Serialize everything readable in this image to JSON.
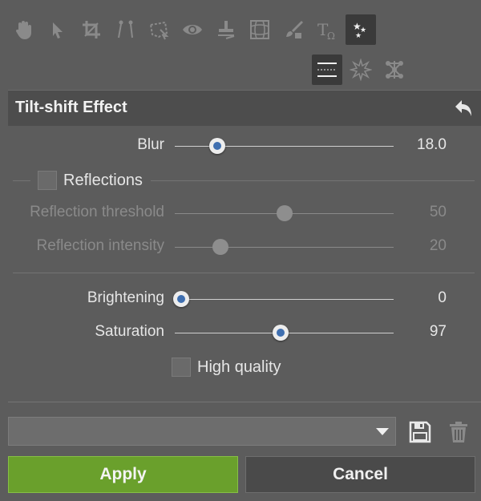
{
  "toolbar": {
    "tools": [
      {
        "icon": "hand-icon"
      },
      {
        "icon": "arrow-pointer-icon"
      },
      {
        "icon": "crop-icon"
      },
      {
        "icon": "straighten-icon"
      },
      {
        "icon": "transform-icon"
      },
      {
        "icon": "eye-icon"
      },
      {
        "icon": "stamp-icon"
      },
      {
        "icon": "grid-warp-icon"
      },
      {
        "icon": "brush-icon"
      },
      {
        "icon": "text-omega-icon"
      },
      {
        "icon": "stars-effects-icon",
        "active": true
      }
    ],
    "subtools": [
      {
        "icon": "tilt-shift-lines-icon",
        "active": true
      },
      {
        "icon": "starburst-icon"
      },
      {
        "icon": "network-nodes-icon"
      }
    ]
  },
  "panel": {
    "title": "Tilt-shift Effect"
  },
  "controls": {
    "blur": {
      "label": "Blur",
      "value": "18.0",
      "fraction": 0.195
    },
    "reflections": {
      "label": "Reflections",
      "checked": false
    },
    "reflection_threshold": {
      "label": "Reflection threshold",
      "value": "50",
      "fraction": 0.5,
      "disabled": true
    },
    "reflection_intensity": {
      "label": "Reflection intensity",
      "value": "20",
      "fraction": 0.21,
      "disabled": true
    },
    "brightening": {
      "label": "Brightening",
      "value": "0",
      "fraction": 0.03
    },
    "saturation": {
      "label": "Saturation",
      "value": "97",
      "fraction": 0.485
    },
    "high_quality": {
      "label": "High quality",
      "checked": false
    }
  },
  "footer": {
    "preset_value": "",
    "apply_label": "Apply",
    "cancel_label": "Cancel"
  },
  "colors": {
    "background": "#5c5c5c",
    "apply": "#6aa02c",
    "slider_accent": "#3f6fb0"
  }
}
